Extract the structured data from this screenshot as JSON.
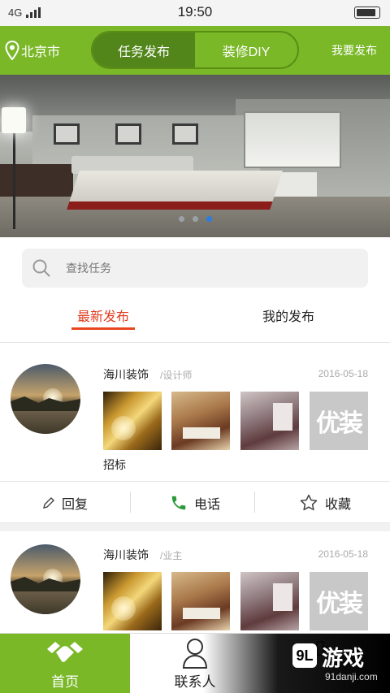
{
  "status_bar": {
    "network": "4G",
    "time": "19:50",
    "battery_level": 0.9
  },
  "header": {
    "city": "北京市",
    "segments": [
      "任务发布",
      "装修DIY"
    ],
    "active_segment": 0,
    "post_link": "我要发布"
  },
  "banner": {
    "slide_count": 3,
    "active_slide": 2
  },
  "search": {
    "placeholder": "查找任务"
  },
  "tabs": {
    "latest": "最新发布",
    "mine": "我的发布"
  },
  "posts": [
    {
      "company": "海川装饰",
      "role": "/设计师",
      "date": "2016-05-18",
      "description": "招标",
      "placeholder_text": "优装"
    },
    {
      "company": "海川装饰",
      "role": "/业主",
      "date": "2016-05-18",
      "placeholder_text": "优装"
    }
  ],
  "actions": {
    "reply": "回复",
    "phone": "电话",
    "favorite": "收藏"
  },
  "bottom_nav": {
    "home": "首页",
    "contacts": "联系人"
  },
  "watermark": {
    "logo": "游戏",
    "badge": "9L",
    "url": "91danji.com"
  },
  "colors": {
    "brand_green": "#7ab828",
    "tab_red": "#e23b1f",
    "phone_green": "#2b9a3a",
    "dot_active": "#2a7de1"
  }
}
